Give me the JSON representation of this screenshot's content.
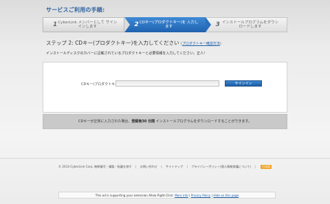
{
  "header": {
    "title": "サービスご利用の手順:"
  },
  "steps": [
    {
      "num": "1",
      "label": "CyberLink メンバーとして サインインします"
    },
    {
      "num": "2",
      "label": "CDキー(プロダクトキー)を 入力します"
    },
    {
      "num": "3",
      "label": "インストールプログラムをダウン ロードします"
    }
  ],
  "main": {
    "step_title": "ステップ 2: CDキー(プロダクトキー)を入力してください",
    "howto_open": "(",
    "howto_link": "プロダクトキー確認方法",
    "howto_close": ")",
    "instruction": "インストールディスクのカバーに記載されているプロダクトキーと必要情報を入力してください。正人!"
  },
  "form": {
    "cd_label": "CDキー(プロダクトキー):",
    "cd_value": "",
    "signin_label": "サインイン"
  },
  "notice": {
    "prefix": "CDキーが正常に入力された場合、",
    "bold": "登録後30 日間",
    "suffix": " インストールプログラムをダウンロードすることができます。"
  },
  "footer": {
    "copyright": "© 2014 CyberLink Corp. 無断複写・複製・転載を禁ず",
    "contact": "お問い合わせ",
    "sitemap": "サイトマップ",
    "privacy": "プライバシーポリシー(個人情報保護について)",
    "badge": "日本語"
  },
  "ad_bar": {
    "text": "This ad is supporting your extension Allow Right-Click:",
    "more_info": "More info",
    "privacy_policy": "Privacy Policy",
    "hide": "Hide on this page"
  },
  "colors": {
    "accent": "#2a70bd",
    "header_title": "#2a5f9e",
    "notice_bg": "#c9c9c9"
  }
}
